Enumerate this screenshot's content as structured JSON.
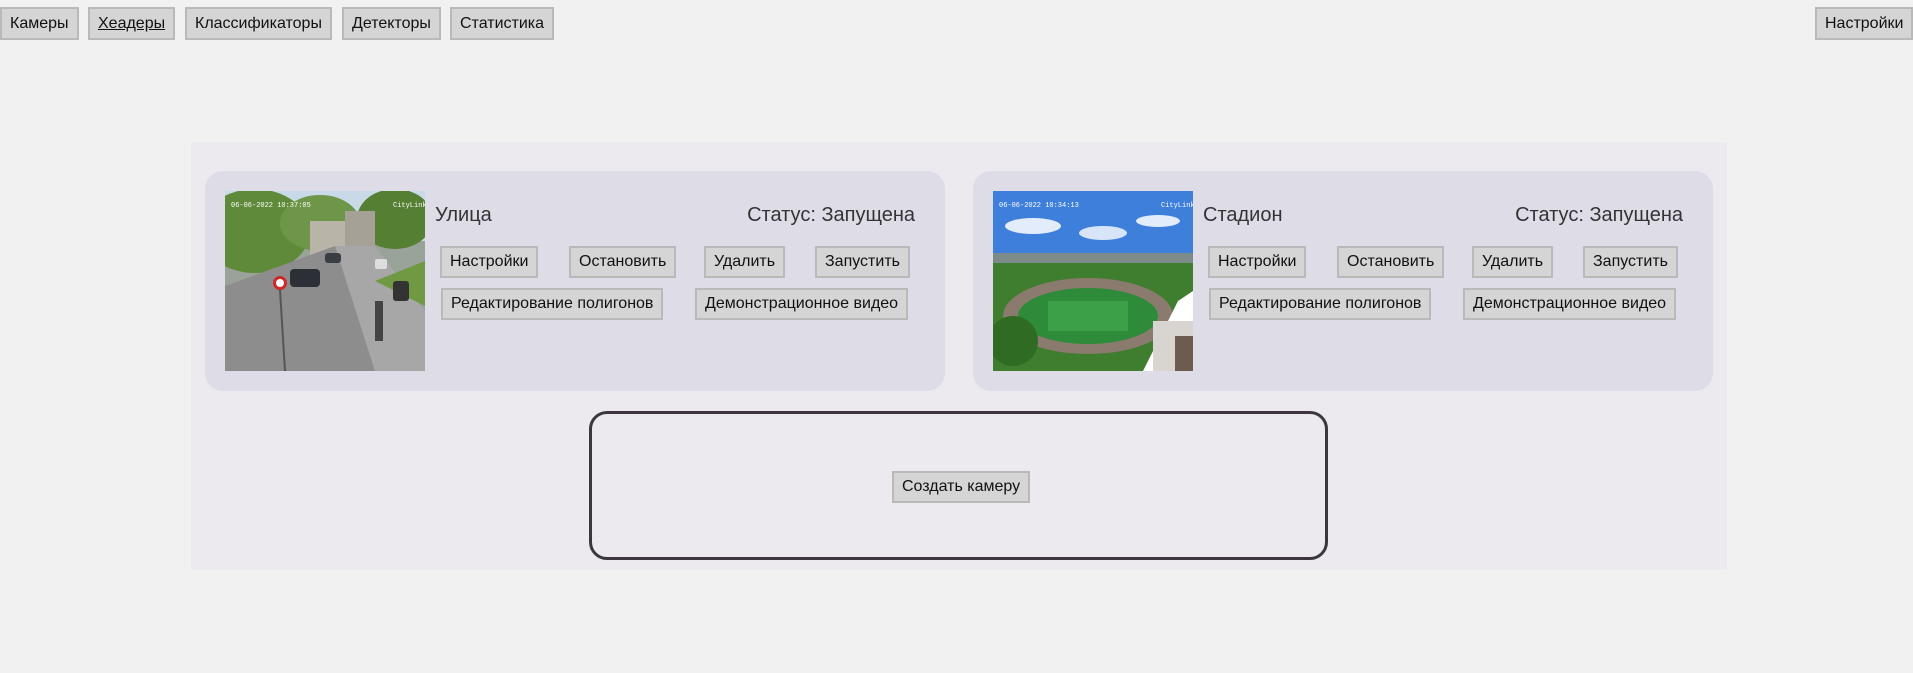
{
  "nav": {
    "items": [
      {
        "label": "Камеры"
      },
      {
        "label": "Хеадеры"
      },
      {
        "label": "Классификаторы"
      },
      {
        "label": "Детекторы"
      },
      {
        "label": "Статистика"
      }
    ],
    "settings_label": "Настройки"
  },
  "cameras": [
    {
      "name": "Улица",
      "status": "Статус: Запущена",
      "overlay_date": "06-06-2022 10:37:05",
      "overlay_brand": "CityLink",
      "buttons": {
        "settings": "Настройки",
        "stop": "Остановить",
        "delete": "Удалить",
        "start": "Запустить",
        "edit_polygons": "Редактирование полигонов",
        "demo_video": "Демонстрационное видео"
      }
    },
    {
      "name": "Стадион",
      "status": "Статус: Запущена",
      "overlay_date": "06-06-2022 10:34:13",
      "overlay_brand": "CityLink",
      "buttons": {
        "settings": "Настройки",
        "stop": "Остановить",
        "delete": "Удалить",
        "start": "Запустить",
        "edit_polygons": "Редактирование полигонов",
        "demo_video": "Демонстрационное видео"
      }
    }
  ],
  "create_camera_label": "Создать камеру"
}
